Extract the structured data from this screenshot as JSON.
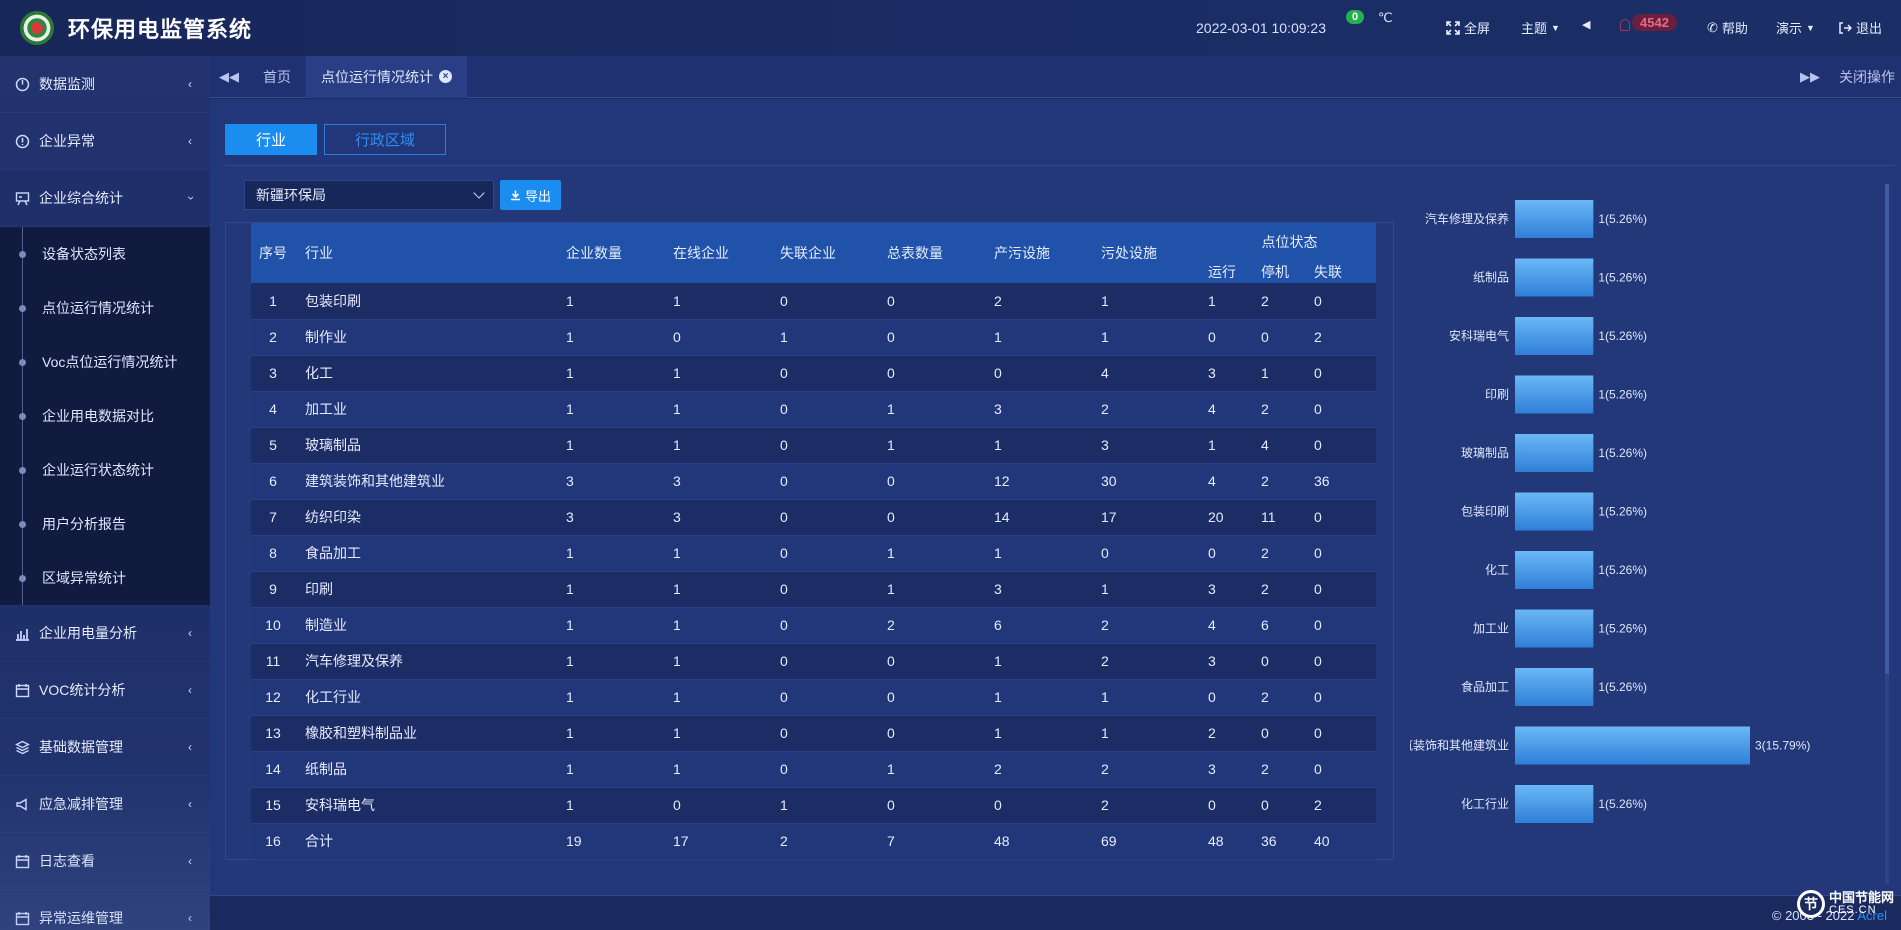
{
  "header": {
    "title": "环保用电监管系统",
    "datetime": "2022-03-01  10:09:23",
    "temp_value": "0",
    "temp_unit": "℃",
    "fullscreen": "全屏",
    "theme": "主题",
    "alarm_count": "4542",
    "help": "帮助",
    "demo": "演示",
    "logout": "退出"
  },
  "sidebar": {
    "items": [
      {
        "label": "数据监测",
        "icon": "dashboard-icon"
      },
      {
        "label": "企业异常",
        "icon": "alert-circle-icon"
      },
      {
        "label": "企业综合统计",
        "icon": "presentation-icon"
      },
      {
        "label": "企业用电量分析",
        "icon": "bar-chart-icon"
      },
      {
        "label": "VOC统计分析",
        "icon": "calendar-icon"
      },
      {
        "label": "基础数据管理",
        "icon": "layers-icon"
      },
      {
        "label": "应急减排管理",
        "icon": "megaphone-icon"
      },
      {
        "label": "日志查看",
        "icon": "calendar-icon"
      },
      {
        "label": "异常运维管理",
        "icon": "calendar-icon"
      }
    ],
    "submenu": [
      "设备状态列表",
      "点位运行情况统计",
      "Voc点位运行情况统计",
      "企业用电数据对比",
      "企业运行状态统计",
      "用户分析报告",
      "区域异常统计"
    ]
  },
  "tabs": {
    "home": "首页",
    "current": "点位运行情况统计",
    "close_ops": "关闭操作"
  },
  "content": {
    "seg_industry": "行业",
    "seg_region": "行政区域",
    "select_value": "新疆环保局",
    "export_label": "导出"
  },
  "table": {
    "headers": [
      "序号",
      "行业",
      "企业数量",
      "在线企业",
      "失联企业",
      "总表数量",
      "产污设施",
      "污处设施",
      "点位状态"
    ],
    "sub_headers": [
      "运行",
      "停机",
      "失联"
    ],
    "rows": [
      [
        "1",
        "包装印刷",
        "1",
        "1",
        "0",
        "0",
        "2",
        "1",
        "1",
        "2",
        "0"
      ],
      [
        "2",
        "制作业",
        "1",
        "0",
        "1",
        "0",
        "1",
        "1",
        "0",
        "0",
        "2"
      ],
      [
        "3",
        "化工",
        "1",
        "1",
        "0",
        "0",
        "0",
        "4",
        "3",
        "1",
        "0"
      ],
      [
        "4",
        "加工业",
        "1",
        "1",
        "0",
        "1",
        "3",
        "2",
        "4",
        "2",
        "0"
      ],
      [
        "5",
        "玻璃制品",
        "1",
        "1",
        "0",
        "1",
        "1",
        "3",
        "1",
        "4",
        "0"
      ],
      [
        "6",
        "建筑装饰和其他建筑业",
        "3",
        "3",
        "0",
        "0",
        "12",
        "30",
        "4",
        "2",
        "36"
      ],
      [
        "7",
        "纺织印染",
        "3",
        "3",
        "0",
        "0",
        "14",
        "17",
        "20",
        "11",
        "0"
      ],
      [
        "8",
        "食品加工",
        "1",
        "1",
        "0",
        "1",
        "1",
        "0",
        "0",
        "2",
        "0"
      ],
      [
        "9",
        "印刷",
        "1",
        "1",
        "0",
        "1",
        "3",
        "1",
        "3",
        "2",
        "0"
      ],
      [
        "10",
        "制造业",
        "1",
        "1",
        "0",
        "2",
        "6",
        "2",
        "4",
        "6",
        "0"
      ],
      [
        "11",
        "汽车修理及保养",
        "1",
        "1",
        "0",
        "0",
        "1",
        "2",
        "3",
        "0",
        "0"
      ],
      [
        "12",
        "化工行业",
        "1",
        "1",
        "0",
        "0",
        "1",
        "1",
        "0",
        "2",
        "0"
      ],
      [
        "13",
        "橡胶和塑料制品业",
        "1",
        "1",
        "0",
        "0",
        "1",
        "1",
        "2",
        "0",
        "0"
      ],
      [
        "14",
        "纸制品",
        "1",
        "1",
        "0",
        "1",
        "2",
        "2",
        "3",
        "2",
        "0"
      ],
      [
        "15",
        "安科瑞电气",
        "1",
        "0",
        "1",
        "0",
        "0",
        "2",
        "0",
        "0",
        "2"
      ],
      [
        "16",
        "合计",
        "19",
        "17",
        "2",
        "7",
        "48",
        "69",
        "48",
        "36",
        "40"
      ]
    ]
  },
  "chart_data": {
    "type": "bar",
    "orientation": "horizontal",
    "categories": [
      "汽车修理及保养",
      "纸制品",
      "安科瑞电气",
      "印刷",
      "玻璃制品",
      "包装印刷",
      "化工",
      "加工业",
      "食品加工",
      "建筑装饰和其他建筑业",
      "化工行业"
    ],
    "values": [
      1,
      1,
      1,
      1,
      1,
      1,
      1,
      1,
      1,
      3,
      1
    ],
    "labels": [
      "1(5.26%)",
      "1(5.26%)",
      "1(5.26%)",
      "1(5.26%)",
      "1(5.26%)",
      "1(5.26%)",
      "1(5.26%)",
      "1(5.26%)",
      "1(5.26%)",
      "3(15.79%)",
      "1(5.26%)"
    ],
    "xlim": [
      0,
      3
    ],
    "bar_color": "#4aa3f0",
    "grid": false
  },
  "footer": {
    "copyright": "© 2003 - 2022",
    "brand": "Acrel",
    "watermark_cn": "中国节能网",
    "watermark_en": "CES.CN"
  },
  "colors": {
    "accent": "#1b8cf0",
    "header_bg": "#1f52a8",
    "row_odd": "#1c2c64",
    "row_even": "#22367a"
  }
}
